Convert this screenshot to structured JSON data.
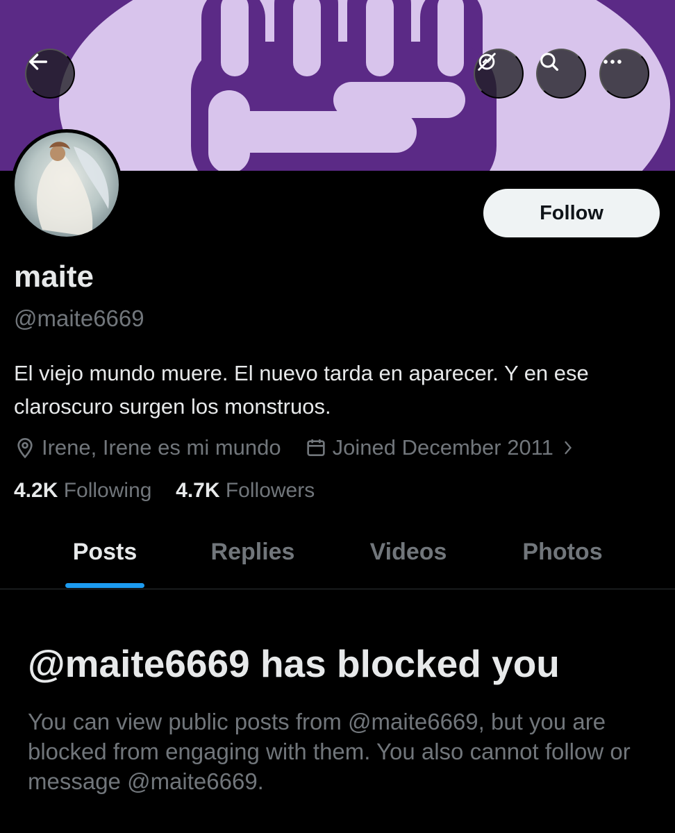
{
  "header": {
    "back_icon": "arrow-left-icon",
    "actions": [
      {
        "icon": "notifications-off-icon"
      },
      {
        "icon": "search-icon"
      },
      {
        "icon": "more-icon"
      }
    ],
    "banner_colors": {
      "background": "#5b2a86",
      "shape": "#d8c4ec"
    }
  },
  "profile": {
    "display_name": "maite",
    "handle": "@maite6669",
    "bio": "El viejo mundo muere. El nuevo tarda en aparecer. Y en ese claroscuro surgen los monstruos.",
    "location": "Irene, Irene es mi mundo",
    "joined": "Joined December 2011",
    "following_count": "4.2K",
    "following_label": "Following",
    "followers_count": "4.7K",
    "followers_label": "Followers",
    "follow_button": "Follow"
  },
  "tabs": [
    {
      "label": "Posts",
      "active": true
    },
    {
      "label": "Replies",
      "active": false
    },
    {
      "label": "Videos",
      "active": false
    },
    {
      "label": "Photos",
      "active": false
    }
  ],
  "blocked": {
    "title": "@maite6669 has blocked you",
    "message": "You can view public posts from @maite6669, but you are blocked from engaging with them. You also cannot follow or message @maite6669."
  },
  "colors": {
    "accent": "#1d9bf0",
    "text_primary": "#e7e9ea",
    "text_secondary": "#71767b",
    "background": "#000000"
  }
}
